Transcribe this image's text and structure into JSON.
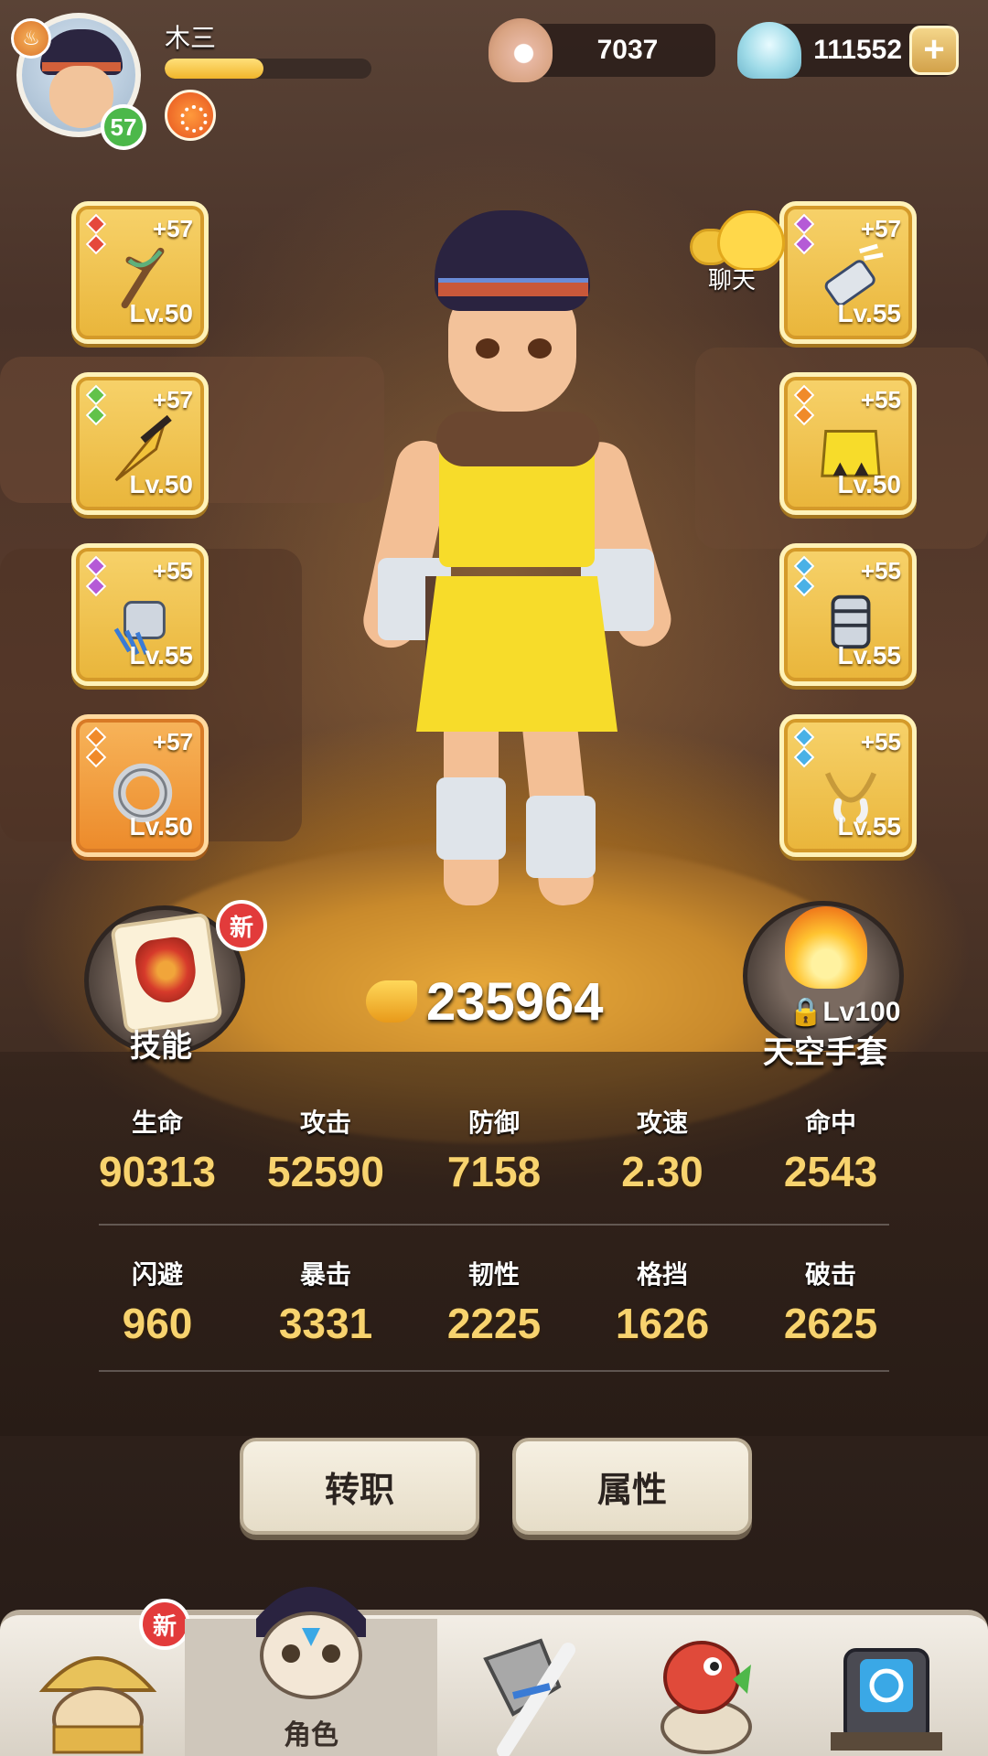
{
  "player": {
    "name": "木三",
    "level": "57",
    "exp_fraction": 0.48
  },
  "currency": {
    "pearls": "7037",
    "shells": "111552",
    "add_label": "+"
  },
  "equipment": {
    "left": [
      {
        "enhance": "+57",
        "level": "Lv.50",
        "item": "slingshot-icon",
        "gems": "red"
      },
      {
        "enhance": "+57",
        "level": "Lv.50",
        "item": "fang-dagger-icon",
        "gems": "green"
      },
      {
        "enhance": "+55",
        "level": "Lv.55",
        "item": "claw-gauntlet-icon",
        "gems": "purple"
      },
      {
        "enhance": "+57",
        "level": "Lv.50",
        "item": "bone-ring-icon",
        "gems": "orange"
      }
    ],
    "right": [
      {
        "enhance": "+57",
        "level": "Lv.55",
        "item": "claw-bracer-icon",
        "gems": "purple"
      },
      {
        "enhance": "+55",
        "level": "Lv.50",
        "item": "yellow-tunic-icon",
        "gems": "orange"
      },
      {
        "enhance": "+55",
        "level": "Lv.55",
        "item": "armor-bracer-icon",
        "gems": "blue"
      },
      {
        "enhance": "+55",
        "level": "Lv.55",
        "item": "tusk-necklace-icon",
        "gems": "blue"
      }
    ]
  },
  "chat": {
    "label": "聊天"
  },
  "skill": {
    "label": "技能",
    "badge": "新"
  },
  "glove": {
    "lock_level": "Lv100",
    "label": "天空手套"
  },
  "power": {
    "value": "235964"
  },
  "stats": {
    "row1": [
      {
        "label": "生命",
        "value": "90313"
      },
      {
        "label": "攻击",
        "value": "52590"
      },
      {
        "label": "防御",
        "value": "7158"
      },
      {
        "label": "攻速",
        "value": "2.30"
      },
      {
        "label": "命中",
        "value": "2543"
      }
    ],
    "row2": [
      {
        "label": "闪避",
        "value": "960"
      },
      {
        "label": "暴击",
        "value": "3331"
      },
      {
        "label": "韧性",
        "value": "2225"
      },
      {
        "label": "格挡",
        "value": "1626"
      },
      {
        "label": "破击",
        "value": "2625"
      }
    ]
  },
  "actions": {
    "job_change": "转职",
    "attributes": "属性"
  },
  "nav": {
    "tabs": [
      {
        "icon": "straw-hat-character-icon",
        "label": "",
        "badge": "新"
      },
      {
        "icon": "hero-character-icon",
        "label": "角色"
      },
      {
        "icon": "stone-weapon-icon",
        "label": ""
      },
      {
        "icon": "dino-pet-icon",
        "label": ""
      },
      {
        "icon": "portal-shrine-icon",
        "label": ""
      }
    ]
  },
  "colors": {
    "slot_gold": "#f2c24f",
    "slot_orange": "#f09a3a",
    "stat_value": "#f8d36e",
    "level_badge": "#4cb84a",
    "new_badge": "#e23b3b"
  }
}
